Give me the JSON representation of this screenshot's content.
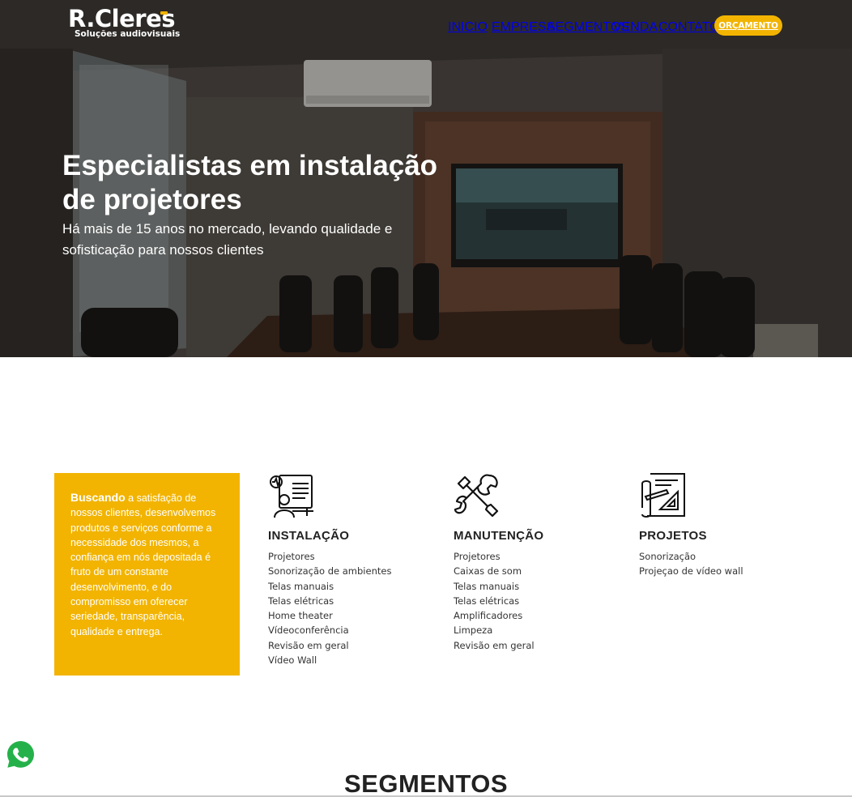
{
  "brand": {
    "name": "R.Cleres",
    "tagline": "Soluções audiovisuais",
    "accent_color": "#f2b400"
  },
  "nav": {
    "items": [
      {
        "label": "INICIO"
      },
      {
        "label": "EMPRESA"
      },
      {
        "label": "SEGMENTOS"
      },
      {
        "label": "VENDA"
      },
      {
        "label": "CONTATO"
      }
    ],
    "cta_label": "ORÇAMENTO"
  },
  "hero": {
    "title_line1": "Especialistas em instalação",
    "title_line2": "de projetores",
    "subtitle_line1": "Há mais de 15 anos no mercado, levando qualidade e",
    "subtitle_line2": "sofisticação para nossos clientes"
  },
  "intro": {
    "lead": "Buscando",
    "text": " a satisfação de nossos clientes, desenvolvemos produtos e serviços conforme a necessidade dos mesmos, a confiança em nós depositada é fruto de um constante desenvolvimento, e do compromisso em oferecer seriedade, transparência, qualidade e entrega."
  },
  "services": [
    {
      "title": "INSTALAÇÃO",
      "icon": "installation-icon",
      "items": [
        "Projetores",
        "Sonorização de ambientes",
        "Telas manuais",
        "Telas elétricas",
        "Home theater",
        "Vídeoconferência",
        "Revisão em geral",
        "Vídeo Wall"
      ]
    },
    {
      "title": "MANUTENÇÃO",
      "icon": "tools-icon",
      "items": [
        "Projetores",
        "Caixas de som",
        "Telas manuais",
        "Telas elétricas",
        "Amplificadores",
        "Limpeza",
        "Revisão em geral"
      ]
    },
    {
      "title": "PROJETOS",
      "icon": "blueprint-icon",
      "items": [
        "Sonorização",
        "Projeçao de vídeo wall"
      ]
    }
  ],
  "segments_heading": "SEGMENTOS",
  "whatsapp_icon": "whatsapp-icon"
}
